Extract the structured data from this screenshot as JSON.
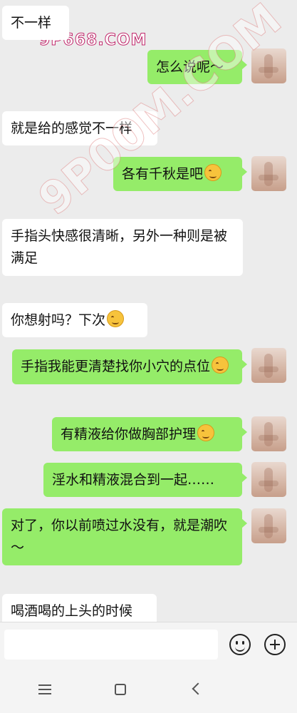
{
  "watermarks": {
    "top": "9P668.COM",
    "diagonal": "9P00M.COM"
  },
  "messages": [
    {
      "side": "left",
      "text": "不一样",
      "emoji": false
    },
    {
      "side": "right",
      "text": "怎么说呢～",
      "emoji": false
    },
    {
      "side": "left",
      "text": "就是给的感觉不一样",
      "emoji": false
    },
    {
      "side": "right",
      "text": "各有千秋是吧",
      "emoji": true,
      "emoji_name": "smile-emoji"
    },
    {
      "side": "left",
      "text": "手指头快感很清晰，另外一种则是被满足",
      "emoji": false
    },
    {
      "side": "left",
      "text": "你想射吗？下次",
      "emoji": true,
      "emoji_name": "blush-emoji"
    },
    {
      "side": "right",
      "text": "手指我能更清楚找你小穴的点位",
      "emoji": true,
      "emoji_name": "blush-emoji"
    },
    {
      "side": "right",
      "text": "有精液给你做胸部护理",
      "emoji": true,
      "emoji_name": "grin-emoji"
    },
    {
      "side": "right",
      "text": "淫水和精液混合到一起……",
      "emoji": false
    },
    {
      "side": "right",
      "text": "对了，你以前喷过水没有，就是潮吹～",
      "emoji": false
    },
    {
      "side": "left",
      "text": "喝酒喝的上头的时候",
      "emoji": false
    }
  ],
  "input_bar": {
    "input_value": "",
    "emoji_button_icon": "smile-face-icon",
    "plus_button_icon": "plus-circle-icon"
  },
  "nav_bar": {
    "menu_icon": "menu-icon",
    "home_icon": "home-icon",
    "back_icon": "back-icon"
  },
  "colors": {
    "background": "#ececec",
    "right_bubble": "#95ec69",
    "left_bubble": "#ffffff"
  }
}
